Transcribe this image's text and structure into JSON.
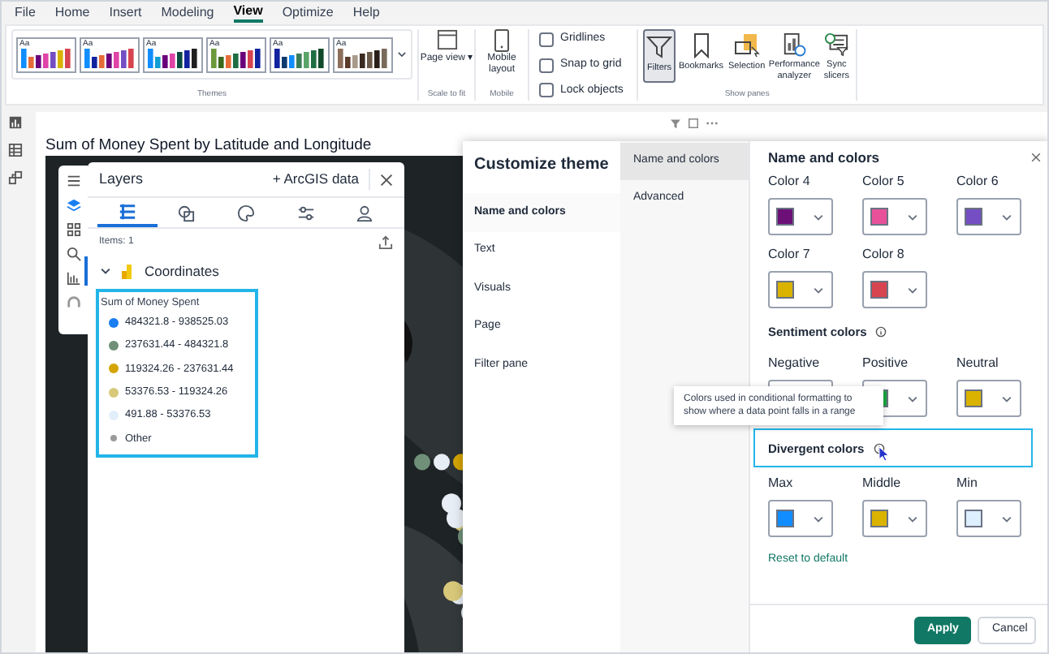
{
  "menu_tabs": [
    {
      "label": "File",
      "selected": false
    },
    {
      "label": "Home",
      "selected": false
    },
    {
      "label": "Insert",
      "selected": false
    },
    {
      "label": "Modeling",
      "selected": false
    },
    {
      "label": "View",
      "selected": true
    },
    {
      "label": "Optimize",
      "selected": false
    },
    {
      "label": "Help",
      "selected": false
    }
  ],
  "ribbon": {
    "themes": {
      "items": [
        {
          "sample": "Aa",
          "selected": false
        },
        {
          "sample": "Aa",
          "selected": false
        },
        {
          "sample": "Aa",
          "selected": false
        },
        {
          "sample": "Aa",
          "selected": false
        },
        {
          "sample": "Aa",
          "selected": false
        },
        {
          "sample": "Aa",
          "selected": false
        }
      ],
      "group_label": "Themes"
    },
    "scale": {
      "button": "Page view ▾",
      "group_label": "Scale to fit"
    },
    "mobile": {
      "button": "Mobile layout",
      "group_label": "Mobile"
    },
    "checkboxes": [
      {
        "label": "Gridlines",
        "checked": false
      },
      {
        "label": "Snap to grid",
        "checked": false
      },
      {
        "label": "Lock objects",
        "checked": false
      }
    ],
    "show_panes": {
      "buttons": [
        {
          "label": "Filters",
          "kind": "filter",
          "selected": true
        },
        {
          "label": "Bookmarks",
          "kind": "bookmark",
          "selected": false
        },
        {
          "label": "Selection",
          "kind": "selection",
          "selected": false
        },
        {
          "label": "Performance analyzer",
          "kind": "performance",
          "selected": false
        },
        {
          "label": "Sync slicers",
          "kind": "sync",
          "selected": false
        }
      ],
      "group_label": "Show panes"
    }
  },
  "visual": {
    "title": "Sum of Money Spent by Latitude and Longitude"
  },
  "layers_panel": {
    "title": "Layers",
    "add_button": "+ ArcGIS data",
    "tabs": [
      {
        "kind": "list",
        "selected": true
      },
      {
        "kind": "shapes",
        "selected": false
      },
      {
        "kind": "palette",
        "selected": false
      },
      {
        "kind": "sliders",
        "selected": false
      },
      {
        "kind": "person",
        "selected": false
      }
    ],
    "items_count": "Items: 1",
    "layer": {
      "name": "Coordinates",
      "expanded": true
    },
    "legend": {
      "title": "Sum of Money Spent",
      "highlighted": true,
      "items": [
        {
          "label": "484321.8 - 938525.03",
          "color": "#1a7ef2"
        },
        {
          "label": "237631.44 - 484321.8",
          "color": "#6f8f79"
        },
        {
          "label": "119324.26 - 237631.44",
          "color": "#d4a400"
        },
        {
          "label": "53376.53 - 119324.26",
          "color": "#d8c97a"
        },
        {
          "label": "491.88 - 53376.53",
          "color": "#e3eefb"
        },
        {
          "label": "Other",
          "color": "#9a9a9a"
        }
      ]
    }
  },
  "dialog": {
    "title": "Customize theme",
    "nav": [
      {
        "label": "Name and colors",
        "selected": true
      },
      {
        "label": "Text",
        "selected": false
      },
      {
        "label": "Visuals",
        "selected": false
      },
      {
        "label": "Page",
        "selected": false
      },
      {
        "label": "Filter pane",
        "selected": false
      }
    ],
    "subnav": [
      {
        "label": "Name and colors",
        "selected": true
      },
      {
        "label": "Advanced",
        "selected": false
      }
    ],
    "heading": "Name and colors",
    "theme_colors": [
      {
        "label": "Color 4",
        "color": "#6c1078"
      },
      {
        "label": "Color 5",
        "color": "#e8519a"
      },
      {
        "label": "Color 6",
        "color": "#744ec2"
      },
      {
        "label": "Color 7",
        "color": "#d9b300"
      },
      {
        "label": "Color 8",
        "color": "#d64550"
      }
    ],
    "sentiment": {
      "title": "Sentiment colors",
      "items": [
        {
          "label": "Negative"
        },
        {
          "label": "Positive",
          "color": "#1aab40"
        },
        {
          "label": "Neutral",
          "color": "#d9b300"
        }
      ]
    },
    "tooltip": "Colors used in conditional formatting to show where a data point falls in a range",
    "divergent": {
      "title": "Divergent colors",
      "focused": true,
      "items": [
        {
          "label": "Max",
          "color": "#118dff"
        },
        {
          "label": "Middle",
          "color": "#d9b300"
        },
        {
          "label": "Min",
          "color": "#deefff"
        }
      ]
    },
    "reset_link": "Reset to default",
    "buttons": [
      {
        "label": "Apply",
        "kind": "primary"
      },
      {
        "label": "Cancel",
        "kind": "secondary"
      }
    ]
  }
}
